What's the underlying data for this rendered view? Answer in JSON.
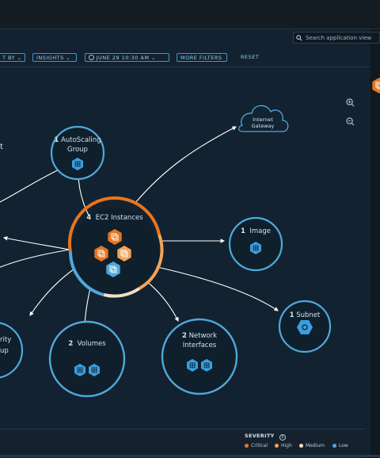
{
  "search": {
    "placeholder": "Search application view"
  },
  "filters": {
    "group_by": "T BY",
    "insights": "INSIGHTS",
    "date": "JUNE 29 10:30 AM",
    "more": "MORE FILTERS",
    "reset": "RESET"
  },
  "edge_text": {
    "left_fragment": "t"
  },
  "nodes": {
    "autoscaling": {
      "count": "1",
      "name_line1": "AutoScaling",
      "name_line2": "Group",
      "icon": "autoscaling-icon"
    },
    "internet_gateway": {
      "line1": "Internet",
      "line2": "Gateway",
      "icon": "cloud-icon"
    },
    "ec2": {
      "count": "4",
      "name": "EC2 Instances",
      "icon": "ec2-instance-icon"
    },
    "image": {
      "count": "1",
      "name": "Image",
      "icon": "image-icon"
    },
    "subnet": {
      "count": "1",
      "name": "Subnet",
      "icon": "subnet-icon"
    },
    "volumes": {
      "count": "2",
      "name": "Volumes",
      "icon": "volume-icon"
    },
    "network_interfaces": {
      "count": "2",
      "name_line1": "Network",
      "name_line2": "Interfaces",
      "icon": "network-interface-icon"
    },
    "security_group_partial": {
      "line1": "rity",
      "line2": "up"
    }
  },
  "severity": {
    "title": "SEVERITY",
    "info_icon": "info-icon",
    "items": [
      {
        "label": "Critical",
        "color": "#e8761d"
      },
      {
        "label": "High",
        "color": "#f2a458"
      },
      {
        "label": "Medium",
        "color": "#f3dfc4"
      },
      {
        "label": "Low",
        "color": "#4ea9dc"
      }
    ]
  },
  "colors": {
    "accent": "#3c97cf",
    "critical": "#e8761d",
    "high": "#f2a458",
    "medium": "#f3dfc4",
    "low": "#4ea9dc"
  }
}
